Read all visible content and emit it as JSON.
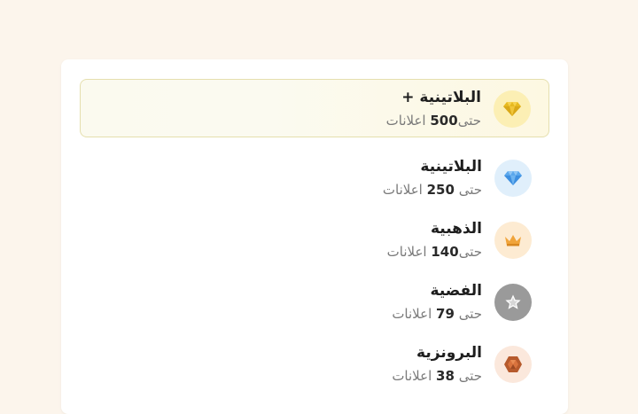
{
  "tiers": [
    {
      "name": "البلاتينية +",
      "prefix": "حتى",
      "count": "500",
      "suffix": "اعلانات",
      "icon": "gold-diamond-icon",
      "badge_bg": "#fcefb4",
      "icon_color": "#e7b91f",
      "selected": true
    },
    {
      "name": "البلاتينية",
      "prefix": "حتى",
      "count": "250",
      "suffix": "اعلانات",
      "icon": "blue-diamond-icon",
      "badge_bg": "#e0effb",
      "icon_color": "#5aa7ec",
      "selected": false
    },
    {
      "name": "الذهبية",
      "prefix": "حتى",
      "count": "140",
      "suffix": "اعلانات",
      "icon": "crown-icon",
      "badge_bg": "#fdebd2",
      "icon_color": "#f0a43a",
      "selected": false
    },
    {
      "name": "الفضية",
      "prefix": "حتى",
      "count": "79",
      "suffix": "اعلانات",
      "icon": "star-icon",
      "badge_bg": "#9a9a9a",
      "icon_color": "#ffffff",
      "selected": false
    },
    {
      "name": "البرونزية",
      "prefix": "حتى",
      "count": "38",
      "suffix": "اعلانات",
      "icon": "bronze-gem-icon",
      "badge_bg": "#fbe8dc",
      "icon_color": "#b65a2c",
      "selected": false
    }
  ]
}
